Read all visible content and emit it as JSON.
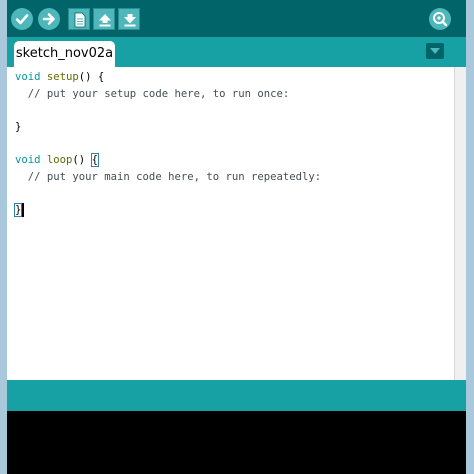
{
  "toolbar": {
    "verify_icon": "check-icon",
    "upload_icon": "arrow-right-icon",
    "new_icon": "new-file-icon",
    "open_icon": "arrow-up-icon",
    "save_icon": "arrow-down-icon",
    "serial_icon": "magnifier-icon"
  },
  "tabs": [
    {
      "label": "sketch_nov02a"
    }
  ],
  "editor": {
    "lines": [
      {
        "kw": "void",
        "fn": "setup",
        "rest": "() {"
      },
      {
        "comment": "  // put your setup code here, to run once:"
      },
      {
        "text": ""
      },
      {
        "text": "}"
      },
      {
        "text": ""
      },
      {
        "kw": "void",
        "fn": "loop",
        "rest": "() ",
        "brace": "{"
      },
      {
        "comment": "  // put your main code here, to run repeatedly:"
      },
      {
        "text": ""
      },
      {
        "text": "}"
      }
    ]
  },
  "colors": {
    "toolbar": "#006468",
    "tabbar": "#17a1a5",
    "button": "#4db7bb",
    "keyword": "#00979c",
    "function": "#5e6d03",
    "comment": "#434f54"
  }
}
